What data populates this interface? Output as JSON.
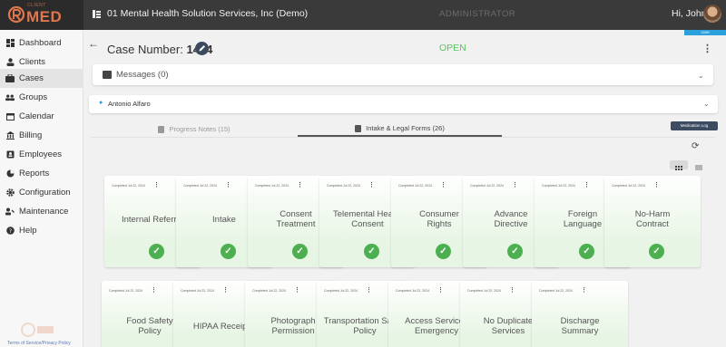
{
  "header": {
    "logo_sub": "CLIENT",
    "logo_text": "MED",
    "company": "01 Mental Health Solution Services, Inc (Demo)",
    "role": "ADMINISTRATOR",
    "greeting": "Hi, John!",
    "badge": "CMH"
  },
  "sidebar": {
    "items": [
      {
        "label": "Dashboard",
        "icon": "dashboard-icon"
      },
      {
        "label": "Clients",
        "icon": "person-icon"
      },
      {
        "label": "Cases",
        "icon": "briefcase-icon",
        "active": true
      },
      {
        "label": "Groups",
        "icon": "group-icon"
      },
      {
        "label": "Calendar",
        "icon": "calendar-icon"
      },
      {
        "label": "Billing",
        "icon": "bank-icon"
      },
      {
        "label": "Employees",
        "icon": "badge-icon"
      },
      {
        "label": "Reports",
        "icon": "pie-chart-icon"
      },
      {
        "label": "Configuration",
        "icon": "gear-icon"
      },
      {
        "label": "Maintenance",
        "icon": "maintenance-icon"
      },
      {
        "label": "Help",
        "icon": "help-icon"
      }
    ],
    "footer_links": "Terms of Service/Privacy Policy"
  },
  "case": {
    "label": "Case Number:",
    "number": "1404",
    "status": "OPEN"
  },
  "messages": {
    "label": "Messages (0)"
  },
  "client": {
    "name": "Antonio Alfaro"
  },
  "tabs": [
    {
      "label": "Progress Notes (15)"
    },
    {
      "label": "Intake & Legal Forms (26)",
      "active": true
    }
  ],
  "med_log": "Medication Log",
  "forms_row1": [
    {
      "date": "Completed Jul 22, 2024",
      "title": "Internal Referral"
    },
    {
      "date": "Completed Jul 22, 2024",
      "title": "Intake"
    },
    {
      "date": "Completed Jul 22, 2024",
      "title": "Consent Treatment"
    },
    {
      "date": "Completed Jul 22, 2024",
      "title": "Telemental Health Consent"
    },
    {
      "date": "Completed Jul 22, 2024",
      "title": "Consumer Rights"
    },
    {
      "date": "Completed Jul 22, 2024",
      "title": "Advance Directive"
    },
    {
      "date": "Completed Jul 22, 2024",
      "title": "Foreign Language"
    },
    {
      "date": "Completed Jul 22, 2024",
      "title": "No-Harm Contract"
    }
  ],
  "forms_row2": [
    {
      "date": "Completed Jul 22, 2024",
      "title": "Food Safety Policy"
    },
    {
      "date": "Completed Jul 22, 2024",
      "title": "HIPAA Receipt"
    },
    {
      "date": "Completed Jul 22, 2024",
      "title": "Photograph Permission"
    },
    {
      "date": "Completed Jul 22, 2024",
      "title": "Transportation Safety Policy"
    },
    {
      "date": "Completed Jul 22, 2024",
      "title": "Access Services Emergency"
    },
    {
      "date": "Completed Jul 22, 2024",
      "title": "No Duplicate Services"
    },
    {
      "date": "Completed Jul 22, 2024",
      "title": "Discharge Summary"
    }
  ],
  "colors": {
    "accent": "#2aa1dc",
    "success": "#4caf50",
    "brand": "#e0764e",
    "topbar": "#3a3a3a"
  }
}
